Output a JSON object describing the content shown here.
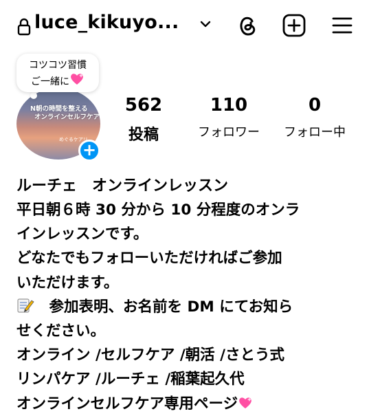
{
  "header": {
    "username": "luce_kikuyo...",
    "icons": [
      "lock-icon",
      "chevron-down-icon",
      "threads-icon",
      "new-post-icon",
      "menu-icon"
    ]
  },
  "profile": {
    "note": {
      "line1": "コツコツ習慣",
      "line2": "ご一緒に"
    },
    "avatar_text": {
      "line1": "N朝の時間を整える",
      "line2": "オンラインセルフケア",
      "line3": "",
      "small": "めぐるケアリ"
    },
    "add_icon_label": "+"
  },
  "stats": {
    "posts": {
      "value": "562",
      "label": "投稿"
    },
    "followers": {
      "value": "110",
      "label": "フォロワー"
    },
    "following": {
      "value": "0",
      "label": "フォロー中"
    }
  },
  "bio": {
    "name": "ルーチェ　オンラインレッスン",
    "lines": [
      "平日朝６時 30 分から 10 分程度のオンラ",
      "インレッスンです。",
      "どなたでもフォローいただければご参加",
      "いただけます。",
      "　参加表明、お名前を DM にてお知ら",
      "せください。",
      "オンライン /セルフケア /朝活 /さとう式",
      "リンパケア /ルーチェ /稲葉起久代",
      "オンラインセルフケア専用ページ"
    ],
    "accent_colors": {
      "heart": "#ff4fa3",
      "plus_badge": "#0095f6"
    }
  }
}
